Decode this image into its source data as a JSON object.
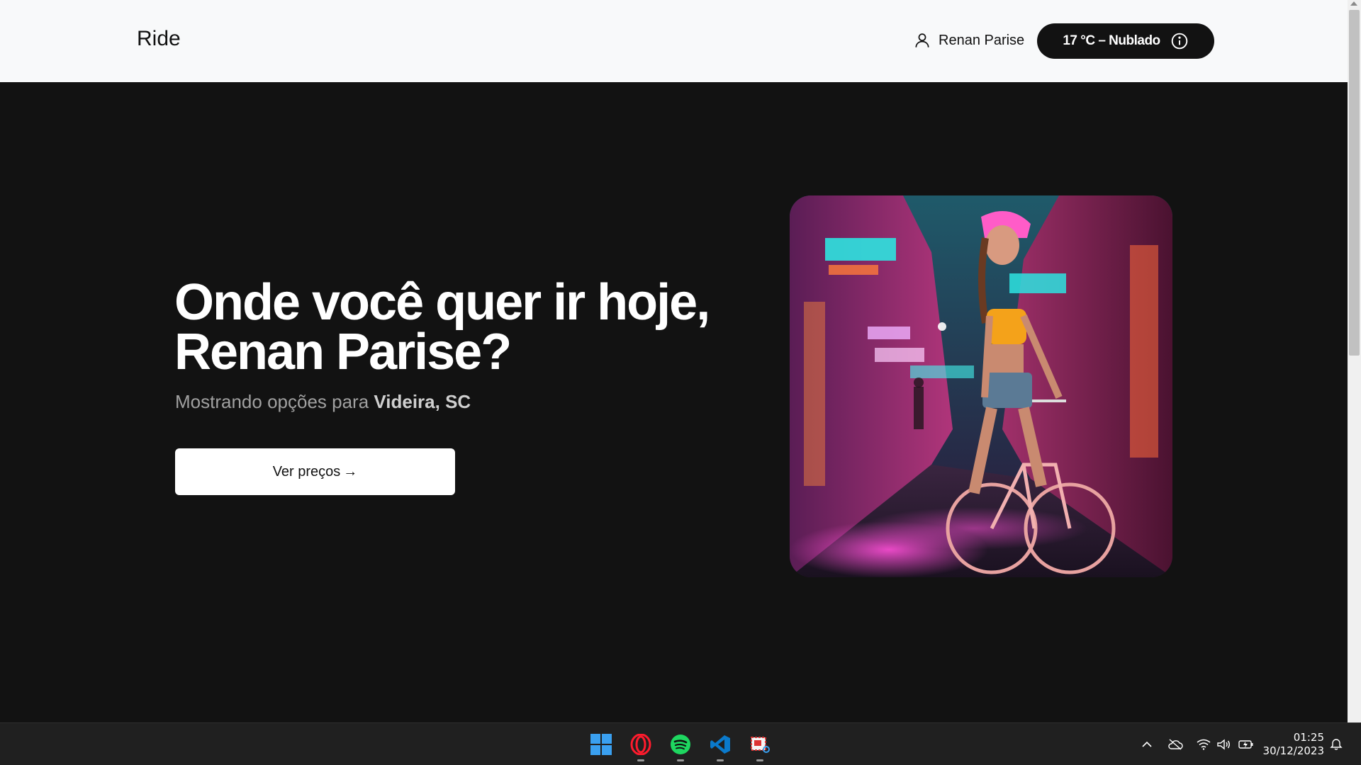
{
  "header": {
    "brand": "Ride",
    "user_name": "Renan Parise",
    "weather_label": "17 °C – Nublado"
  },
  "hero": {
    "title_line1": "Onde você quer ir hoje,",
    "title_line2": "Renan Parise?",
    "subtitle_prefix": "Mostrando opções para ",
    "subtitle_location": "Videira, SC",
    "cta_label": "Ver preços",
    "cta_arrow": "→"
  },
  "taskbar": {
    "apps": [
      "windows-start-icon",
      "opera-icon",
      "spotify-icon",
      "vscode-icon",
      "snipping-tool-icon"
    ],
    "time": "01:25",
    "date": "30/12/2023"
  },
  "colors": {
    "hero_bg": "#121212",
    "header_bg": "#f8f9fa",
    "weather_pill": "#121212",
    "spotify": "#1ed760",
    "opera": "#ff1b2d",
    "vscode": "#0a7acc"
  }
}
